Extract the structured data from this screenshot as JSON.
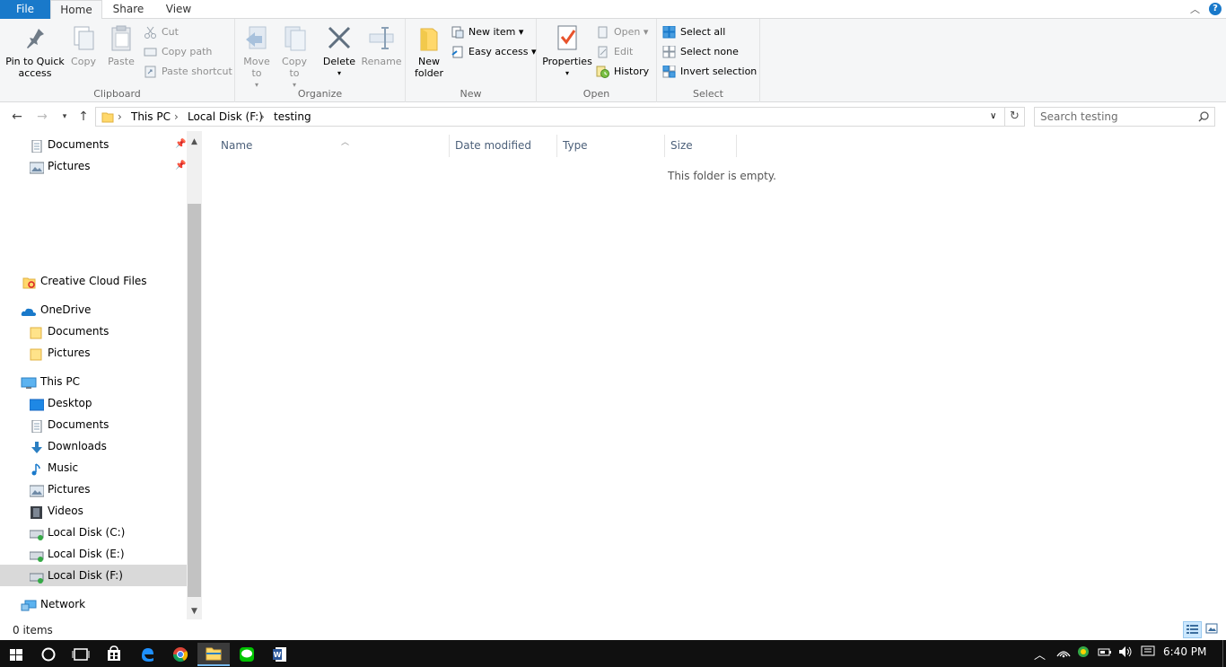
{
  "ribbon_tabs": {
    "file": "File",
    "home": "Home",
    "share": "Share",
    "view": "View",
    "help": "?"
  },
  "clipboard": {
    "group_label": "Clipboard",
    "pin_to_quick_access": "Pin to Quick access",
    "copy": "Copy",
    "paste": "Paste",
    "cut": "Cut",
    "copy_path": "Copy path",
    "paste_shortcut": "Paste shortcut"
  },
  "organize": {
    "group_label": "Organize",
    "move_to": "Move to",
    "copy_to": "Copy to",
    "delete": "Delete",
    "rename": "Rename"
  },
  "new": {
    "group_label": "New",
    "new_folder": "New folder",
    "new_item": "New item",
    "easy_access": "Easy access"
  },
  "open": {
    "group_label": "Open",
    "properties": "Properties",
    "open": "Open",
    "edit": "Edit",
    "history": "History"
  },
  "select": {
    "group_label": "Select",
    "select_all": "Select all",
    "select_none": "Select none",
    "invert_selection": "Invert selection"
  },
  "address": {
    "crumbs": [
      "This PC",
      "Local Disk (F:)",
      "testing"
    ],
    "search_placeholder": "Search testing"
  },
  "nav": {
    "quick_access_items": [
      {
        "label": "Documents",
        "pinned": true
      },
      {
        "label": "Pictures",
        "pinned": true
      }
    ],
    "creative_cloud": "Creative Cloud Files",
    "onedrive": "OneDrive",
    "onedrive_items": [
      "Documents",
      "Pictures"
    ],
    "this_pc": "This PC",
    "this_pc_items": [
      "Desktop",
      "Documents",
      "Downloads",
      "Music",
      "Pictures",
      "Videos",
      "Local Disk (C:)",
      "Local Disk (E:)",
      "Local Disk (F:)"
    ],
    "selected": "Local Disk (F:)",
    "network": "Network"
  },
  "columns": [
    "Name",
    "Date modified",
    "Type",
    "Size"
  ],
  "empty_message": "This folder is empty.",
  "status": {
    "items": "0 items"
  },
  "taskbar": {
    "time": "6:40 PM"
  },
  "colors": {
    "accent": "#1979ca",
    "selection": "#d9d9d9",
    "folder": "#ffd86b"
  }
}
